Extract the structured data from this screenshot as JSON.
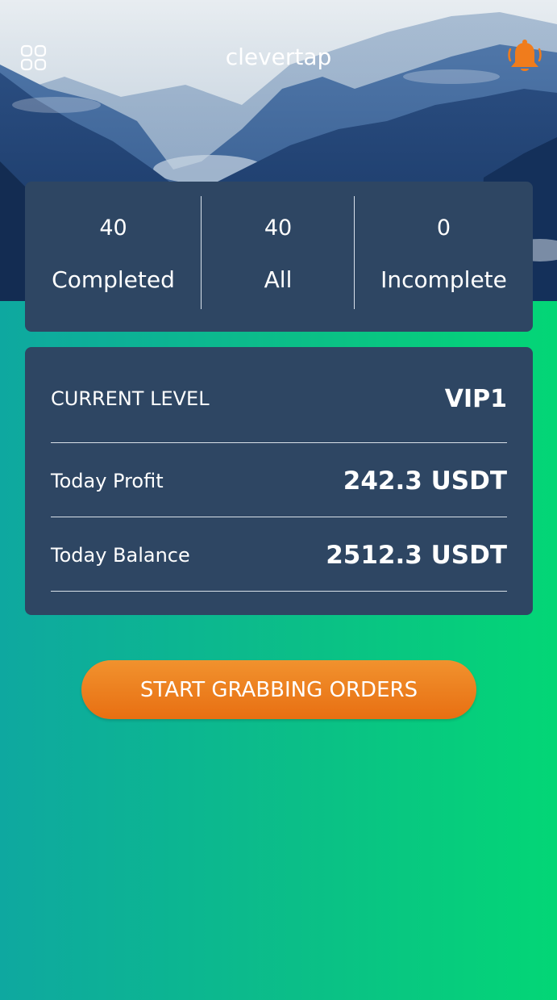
{
  "header": {
    "title": "clevertap",
    "menu_icon": "grid-menu-icon",
    "notification_icon": "bell-icon",
    "notification_color": "#f07c1c"
  },
  "stats": [
    {
      "value": "40",
      "label": "Completed"
    },
    {
      "value": "40",
      "label": "All"
    },
    {
      "value": "0",
      "label": "Incomplete"
    }
  ],
  "account": {
    "current_level_label": "CURRENT LEVEL",
    "current_level_value": "VIP1",
    "today_profit_label": "Today Profit",
    "today_profit_value": "242.3 USDT",
    "today_balance_label": "Today Balance",
    "today_balance_value": "2512.3 USDT"
  },
  "cta": {
    "label": "START GRABBING ORDERS",
    "color": "#ec7d1c"
  },
  "colors": {
    "card_bg": "#2e4663",
    "gradient_start": "#0ea8a0",
    "gradient_end": "#03d676"
  }
}
